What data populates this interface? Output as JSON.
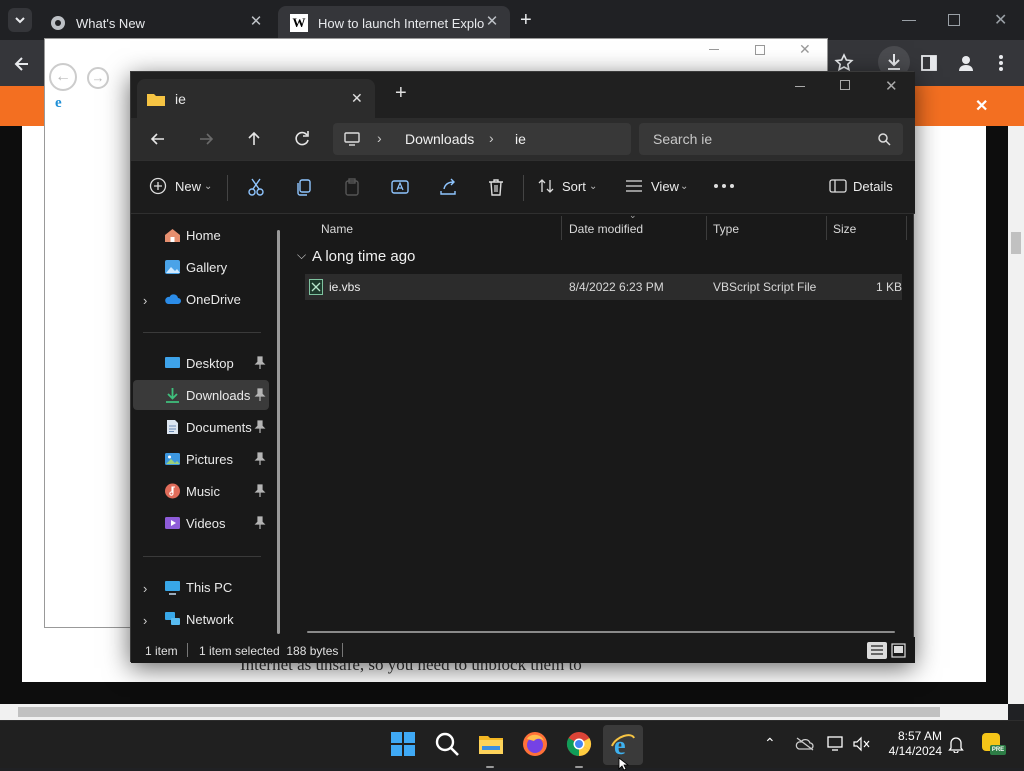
{
  "chrome": {
    "tabs": [
      {
        "title": "What's New"
      },
      {
        "title": "How to launch Internet Explorer"
      }
    ],
    "new_tab_label": "+"
  },
  "page": {
    "partial_text": "Internet as unsafe, so you need to unblock them to"
  },
  "explorer": {
    "tab_title": "ie",
    "breadcrumb": [
      "Downloads",
      "ie"
    ],
    "search_placeholder": "Search ie",
    "commands": {
      "new": "New",
      "sort": "Sort",
      "view": "View",
      "details": "Details"
    },
    "sidebar": {
      "top": [
        {
          "label": "Home",
          "icon": "home-icon"
        },
        {
          "label": "Gallery",
          "icon": "gallery-icon"
        },
        {
          "label": "OneDrive",
          "icon": "cloud-icon"
        }
      ],
      "pinned": [
        {
          "label": "Desktop",
          "icon": "desktop-icon"
        },
        {
          "label": "Downloads",
          "icon": "download-icon",
          "selected": true
        },
        {
          "label": "Documents",
          "icon": "documents-icon"
        },
        {
          "label": "Pictures",
          "icon": "pictures-icon"
        },
        {
          "label": "Music",
          "icon": "music-icon"
        },
        {
          "label": "Videos",
          "icon": "videos-icon"
        }
      ],
      "bottom": [
        {
          "label": "This PC",
          "icon": "pc-icon"
        },
        {
          "label": "Network",
          "icon": "network-icon"
        }
      ]
    },
    "columns": [
      "Name",
      "Date modified",
      "Type",
      "Size"
    ],
    "group_label": "A long time ago",
    "files": [
      {
        "name": "ie.vbs",
        "date": "8/4/2022 6:23 PM",
        "type": "VBScript Script File",
        "size": "1 KB"
      }
    ],
    "status": {
      "count": "1 item",
      "selected": "1 item selected  188 bytes"
    }
  },
  "taskbar": {
    "time": "8:57 AM",
    "date": "4/14/2024"
  }
}
